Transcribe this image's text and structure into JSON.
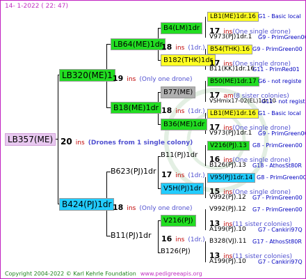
{
  "header": "14-  1-2022 (  22: 47)",
  "footer": {
    "copyright": "Copyright 2004-2022 © Karl Kehrle Foundation",
    "url": "www.pedigreeapis.org"
  },
  "root": {
    "name": "LB357(ME)",
    "count": "20",
    "ins": "ins",
    "note": "(Drones from 1 single colony)",
    "color": "#e8c8f0"
  },
  "gen1": [
    {
      "name": "LB320(ME)1",
      "count": "19",
      "ins": "ins",
      "note": "(Only one drone)"
    },
    {
      "name": "B424(PJ)1dr",
      "count": "18",
      "ins": "ins",
      "note": "(Only one drone)"
    }
  ],
  "gen2": [
    {
      "name": "LB64(ME)1dr",
      "count": "18",
      "ins": "ins",
      "note": "(1dr.)"
    },
    {
      "name": "B18(ME)1dr",
      "count": "18",
      "ins": "ins",
      "note": "(1dr.)"
    },
    {
      "name": "B623(PJ)1dr",
      "count": "17",
      "ins": "ins",
      "note": "(1dr.)"
    },
    {
      "name": "B11(PJ)1dr",
      "count": "16",
      "ins": "ins",
      "note": "(1dr.)"
    }
  ],
  "gen3": [
    {
      "name": "B4(LM)1dr"
    },
    {
      "name": "B182(THK)1dr"
    },
    {
      "name": "B77(ME)"
    },
    {
      "name": "B36(ME)1dr"
    },
    {
      "name": "B11(PJ)1dr"
    },
    {
      "name": "V5H(PJ)1dr"
    },
    {
      "name": "V216(PJ)"
    },
    {
      "name": "B126(PJ)"
    }
  ],
  "gen4": [
    {
      "name": "LB1(ME)1dr.16",
      "info": "G1 - Basic local"
    },
    {
      "count": "17",
      "ins": "ins",
      "note": "(One single drone)"
    },
    {
      "name": "V973(PJ)1dr.1",
      "info": "G9 - PrimGreen00"
    },
    {
      "name": "B54(THK).16",
      "info": "G9 - PrimGreen00"
    },
    {
      "count": "17",
      "ins": "ins",
      "note": "(One single drone)"
    },
    {
      "name": "B11(KK)1dr.16",
      "info": "G11 - PrimRed01"
    },
    {
      "name": "B50(ME)1dr.17",
      "info": "G6 - not registe"
    },
    {
      "count": "17",
      "ins": "am",
      "note": "(8 sister colonies)"
    },
    {
      "name": "VSHmix17-02(EL)1dr.10",
      "info": "G11 - not registe"
    },
    {
      "name": "LB1(ME)1dr.16",
      "info": "G1 - Basic local"
    },
    {
      "count": "17",
      "ins": "ins",
      "note": "(One single drone)"
    },
    {
      "name": "V973(PJ)1dr.1",
      "info": "G9 - PrimGreen00"
    },
    {
      "name": "V216(PJ).13",
      "info": "G8 - PrimGreen00"
    },
    {
      "count": "16",
      "ins": "ins",
      "note": "(One single drone)"
    },
    {
      "name": "B126(PJ).13",
      "info": "G18 - AthosSt80R"
    },
    {
      "name": "V95(PJ)1dr.14",
      "info": "G8 - PrimGreen00"
    },
    {
      "count": "15",
      "ins": "ins",
      "note": "(One single drone)"
    },
    {
      "name": "V992(PJ).12",
      "info": "G7 - PrimGreen00"
    },
    {
      "name": "V992(PJ).12",
      "info": "G7 - PrimGreen00"
    },
    {
      "count": "13",
      "ins": "ins",
      "note": "(11 sister colonies)"
    },
    {
      "name": "A199(PJ).10",
      "info": "G7 - Cankiri97Q"
    },
    {
      "name": "B328(VJ).11",
      "info": "G17 - AthosSt80R"
    },
    {
      "count": "13",
      "ins": "ins",
      "note": "(11 sister colonies)"
    },
    {
      "name": "A199(PJ).10",
      "info": "G7 - Cankiri97Q"
    }
  ]
}
